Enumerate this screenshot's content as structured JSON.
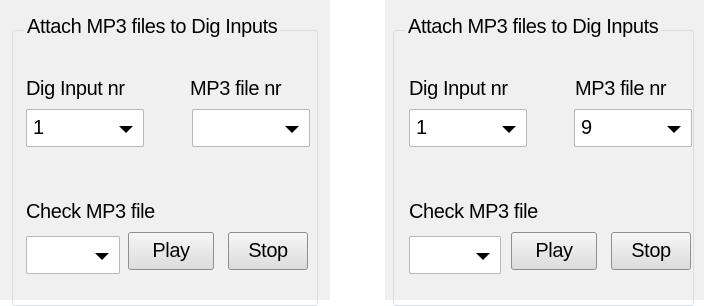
{
  "panels": [
    {
      "group_title": "Attach MP3 files to Dig Inputs",
      "dig_input_label": "Dig Input nr",
      "mp3_file_label": "MP3 file nr",
      "dig_input_value": "1",
      "mp3_file_value": "",
      "check_label": "Check MP3 file",
      "check_value": "",
      "play_label": "Play",
      "stop_label": "Stop"
    },
    {
      "group_title": "Attach MP3 files to Dig Inputs",
      "dig_input_label": "Dig Input nr",
      "mp3_file_label": "MP3 file nr",
      "dig_input_value": "1",
      "mp3_file_value": "9",
      "check_label": "Check MP3 file",
      "check_value": "",
      "play_label": "Play",
      "stop_label": "Stop"
    }
  ]
}
